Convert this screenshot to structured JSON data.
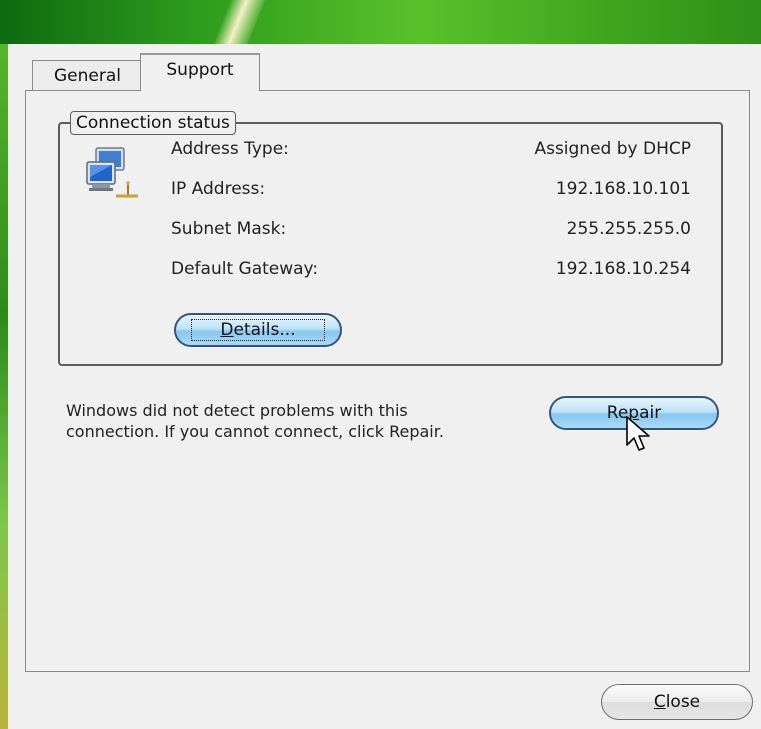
{
  "tabs": [
    {
      "label": "General",
      "selected": false
    },
    {
      "label": "Support",
      "selected": true
    }
  ],
  "connection_status": {
    "legend": "Connection status",
    "icon": "network-computer-icon",
    "fields": [
      {
        "label": "Address Type:",
        "value": "Assigned by DHCP"
      },
      {
        "label": "IP Address:",
        "value": "192.168.10.101"
      },
      {
        "label": "Subnet Mask:",
        "value": "255.255.255.0"
      },
      {
        "label": "Default Gateway:",
        "value": "192.168.10.254"
      }
    ],
    "details_button": {
      "before": "",
      "mnemonic": "D",
      "after": "etails..."
    }
  },
  "repair": {
    "message": "Windows did not detect problems with this connection. If you cannot connect, click Repair.",
    "button": {
      "before": "Re",
      "mnemonic": "p",
      "after": "air"
    }
  },
  "close_button": {
    "before": "",
    "mnemonic": "C",
    "after": "lose"
  },
  "colors": {
    "button_border": "#36557d",
    "button_fill": "#a9dbf7",
    "panel_bg": "#f0f0f0",
    "wallpaper_green": "#2c9b1c"
  }
}
